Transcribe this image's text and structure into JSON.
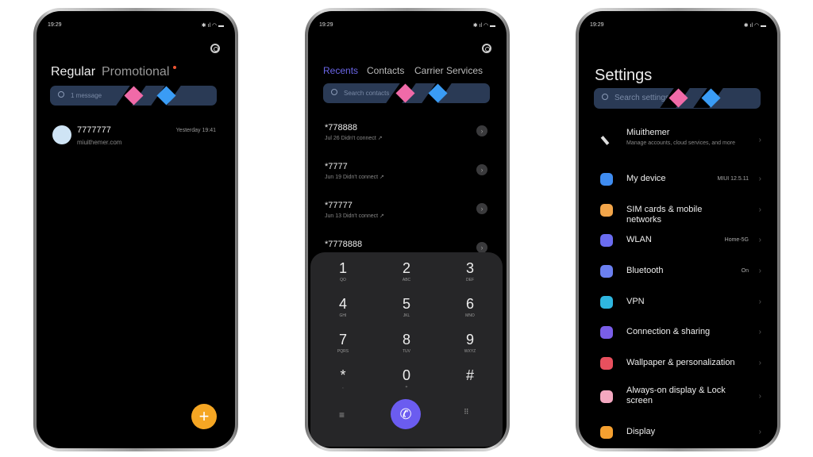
{
  "status": {
    "time": "19:29"
  },
  "messages": {
    "tabs": [
      {
        "label": "Regular",
        "active": true
      },
      {
        "label": "Promotional",
        "badge": true
      }
    ],
    "search_placeholder": "1 message",
    "conversations": [
      {
        "name": "7777777",
        "preview": "miuithemer.com",
        "time": "Yesterday 19:41"
      }
    ],
    "fab_icon": "plus-icon",
    "accent": "#f5a623"
  },
  "phone_app": {
    "tabs": [
      {
        "label": "Recents",
        "active": true
      },
      {
        "label": "Contacts"
      },
      {
        "label": "Carrier Services"
      }
    ],
    "search_placeholder": "Search contacts",
    "recents": [
      {
        "number": "*778888",
        "detail": "Jul 26 Didn't connect"
      },
      {
        "number": "*7777",
        "detail": "Jun 19 Didn't connect"
      },
      {
        "number": "*77777",
        "detail": "Jun 13 Didn't connect"
      },
      {
        "number": "*7778888",
        "detail": ""
      }
    ],
    "keys": [
      {
        "d": "1",
        "l": "QO"
      },
      {
        "d": "2",
        "l": "ABC"
      },
      {
        "d": "3",
        "l": "DEF"
      },
      {
        "d": "4",
        "l": "GHI"
      },
      {
        "d": "5",
        "l": "JKL"
      },
      {
        "d": "6",
        "l": "MNO"
      },
      {
        "d": "7",
        "l": "PQRS"
      },
      {
        "d": "8",
        "l": "TUV"
      },
      {
        "d": "9",
        "l": "WXYZ"
      },
      {
        "d": "*",
        "l": ","
      },
      {
        "d": "0",
        "l": "+"
      },
      {
        "d": "#",
        "l": ""
      }
    ],
    "accent": "#6b5cf0"
  },
  "settings": {
    "title": "Settings",
    "search_placeholder": "Search settings",
    "account": {
      "name": "Miuithemer",
      "subtitle": "Manage accounts, cloud services, and more"
    },
    "items": [
      {
        "label": "My device",
        "value": "MIUI 12.5.11",
        "icon": "phone-icon",
        "color": "#3f8cf0"
      },
      {
        "label": "SIM cards & mobile networks",
        "value": "",
        "icon": "sim-icon",
        "color": "#f2a54a"
      },
      {
        "label": "WLAN",
        "value": "Home-5G",
        "icon": "wifi-icon",
        "color": "#6a6cf0"
      },
      {
        "label": "Bluetooth",
        "value": "On",
        "icon": "bluetooth-icon",
        "color": "#6b7ff0"
      },
      {
        "label": "VPN",
        "value": "",
        "icon": "vpn-icon",
        "color": "#2fb6e0"
      },
      {
        "label": "Connection & sharing",
        "value": "",
        "icon": "connection-icon",
        "color": "#7a5ee8"
      },
      {
        "label": "Wallpaper & personalization",
        "value": "",
        "icon": "palette-icon",
        "color": "#e8505e"
      },
      {
        "label": "Always-on display & Lock screen",
        "value": "",
        "icon": "lock-icon",
        "color": "#f4a8c0"
      },
      {
        "label": "Display",
        "value": "",
        "icon": "display-icon",
        "color": "#f5a030"
      }
    ]
  },
  "colors": {
    "pink": "#f06aa8",
    "blue": "#3a9cf5",
    "searchbar": "#2a3a55"
  }
}
